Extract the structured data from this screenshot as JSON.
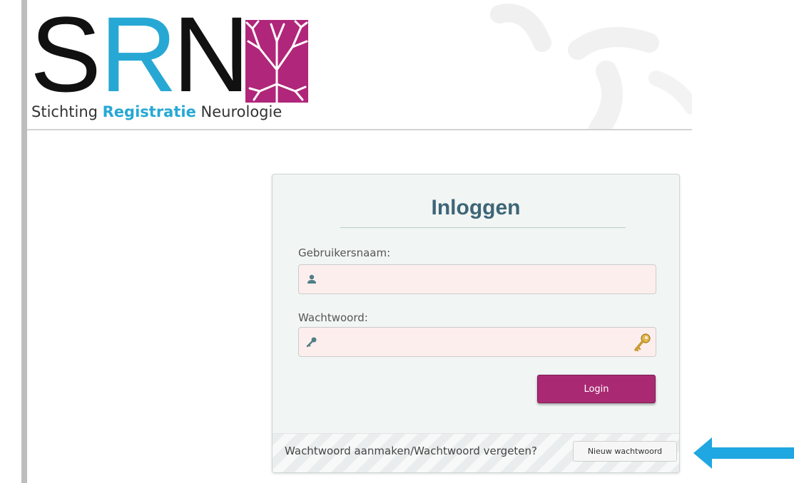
{
  "logo": {
    "letters": [
      "S",
      "R",
      "N"
    ],
    "subtitle_pre": "Stichting ",
    "subtitle_highlight": "Registratie",
    "subtitle_post": " Neurologie",
    "brand_black": "#111111",
    "brand_blue": "#27a8d4",
    "brand_magenta": "#b0267a"
  },
  "login": {
    "title": "Inloggen",
    "username_label": "Gebruikersnaam:",
    "username_value": "",
    "password_label": "Wachtwoord:",
    "password_value": "",
    "button_label": "Login",
    "username_icon": "user-icon",
    "password_icon": "key-icon",
    "password_manager_icon": "key-icon"
  },
  "footer": {
    "prompt": "Wachtwoord aanmaken/Wachtwoord vergeten?",
    "button_label": "Nieuw wachtwoord"
  },
  "annotation": {
    "arrow_color": "#1ea7e1",
    "arrow_icon": "arrow-left-icon"
  }
}
